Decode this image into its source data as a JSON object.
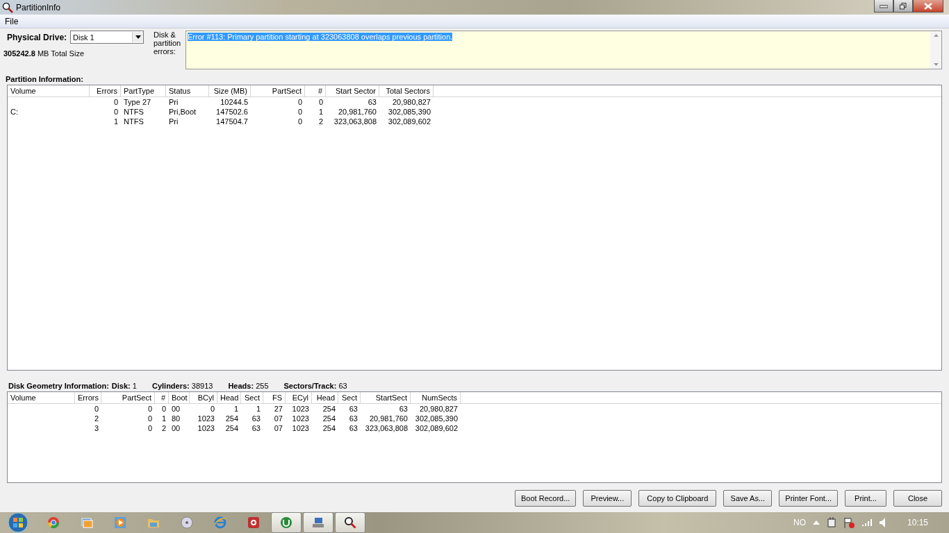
{
  "window": {
    "title": "PartitionInfo"
  },
  "menu": [
    "File"
  ],
  "drive": {
    "label": "Physical Drive:",
    "value": "Disk 1",
    "total": "**305242.8** MB Total Size"
  },
  "errors": {
    "label": "Disk & partition errors:",
    "messages": [
      {
        "text": "Error #113: Primary partition starting at 323063808 overlaps previous partition.",
        "highlighted": true
      }
    ]
  },
  "partition_table": {
    "title": "Partition Information:",
    "columns": [
      "Volume",
      "Errors",
      "PartType",
      "Status",
      "Size (MB)",
      "PartSect",
      "#",
      "Start Sector",
      "Total Sectors"
    ],
    "rows": [
      [
        "",
        "0",
        "Type 27",
        "Pri",
        "10244.5",
        "0",
        "0",
        "63",
        "20,980,827"
      ],
      [
        "C:",
        "0",
        "NTFS",
        "Pri,Boot",
        "147502.6",
        "0",
        "1",
        "20,981,760",
        "302,085,390"
      ],
      [
        "",
        "1",
        "NTFS",
        "Pri",
        "147504.7",
        "0",
        "2",
        "323,063,808",
        "302,089,602"
      ]
    ]
  },
  "geometry": {
    "title": "Disk Geometry Information:",
    "fields": [
      "**Disk:** 1",
      "**Cylinders:** 38913",
      "**Heads:** 255",
      "**Sectors/Track:** 63"
    ],
    "columns": [
      "Volume",
      "Errors",
      "PartSect",
      "#",
      "Boot",
      "BCyl",
      "Head",
      "Sect",
      "FS",
      "ECyl",
      "Head",
      "Sect",
      "StartSect",
      "NumSects"
    ],
    "rows": [
      [
        "",
        "0",
        "0",
        "0",
        "00",
        "0",
        "1",
        "1",
        "27",
        "1023",
        "254",
        "63",
        "63",
        "20,980,827"
      ],
      [
        "",
        "2",
        "0",
        "1",
        "80",
        "1023",
        "254",
        "63",
        "07",
        "1023",
        "254",
        "63",
        "20,981,760",
        "302,085,390"
      ],
      [
        "",
        "3",
        "0",
        "2",
        "00",
        "1023",
        "254",
        "63",
        "07",
        "1023",
        "254",
        "63",
        "323,063,808",
        "302,089,602"
      ]
    ]
  },
  "buttons": [
    "Boot Record...",
    "Preview...",
    "Copy to Clipboard",
    "Save As...",
    "Printer Font...",
    "Print...",
    "Close"
  ],
  "taskbar": {
    "items": [
      {
        "kind": "browser",
        "running": false
      },
      {
        "kind": "pictures",
        "running": false
      },
      {
        "kind": "media",
        "running": false
      },
      {
        "kind": "folder",
        "running": false
      },
      {
        "kind": "disc",
        "running": false
      },
      {
        "kind": "web",
        "running": false
      },
      {
        "kind": "record",
        "running": false
      },
      {
        "kind": "torrent",
        "running": true
      },
      {
        "kind": "network",
        "running": true
      },
      {
        "kind": "magnifier",
        "running": true
      }
    ],
    "language": "NO",
    "clock": "10:15"
  }
}
